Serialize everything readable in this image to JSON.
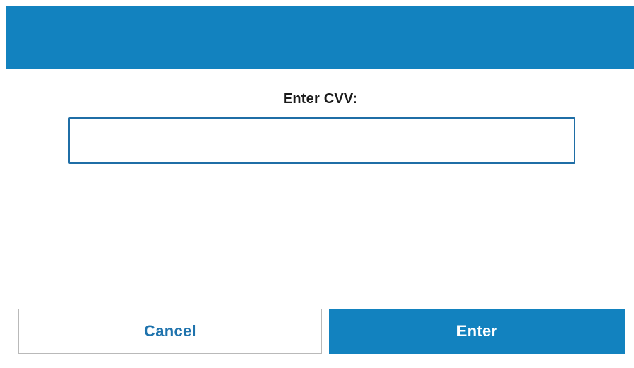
{
  "dialog": {
    "prompt_label": "Enter CVV:",
    "cvv_value": "",
    "cvv_placeholder": "",
    "cancel_label": "Cancel",
    "enter_label": "Enter"
  },
  "colors": {
    "primary": "#1282bf",
    "input_border": "#1f6ea6",
    "cancel_text": "#1f73ad",
    "cancel_border": "#b9b9b9",
    "background": "#ffffff",
    "label_text": "#1a1a1a"
  }
}
